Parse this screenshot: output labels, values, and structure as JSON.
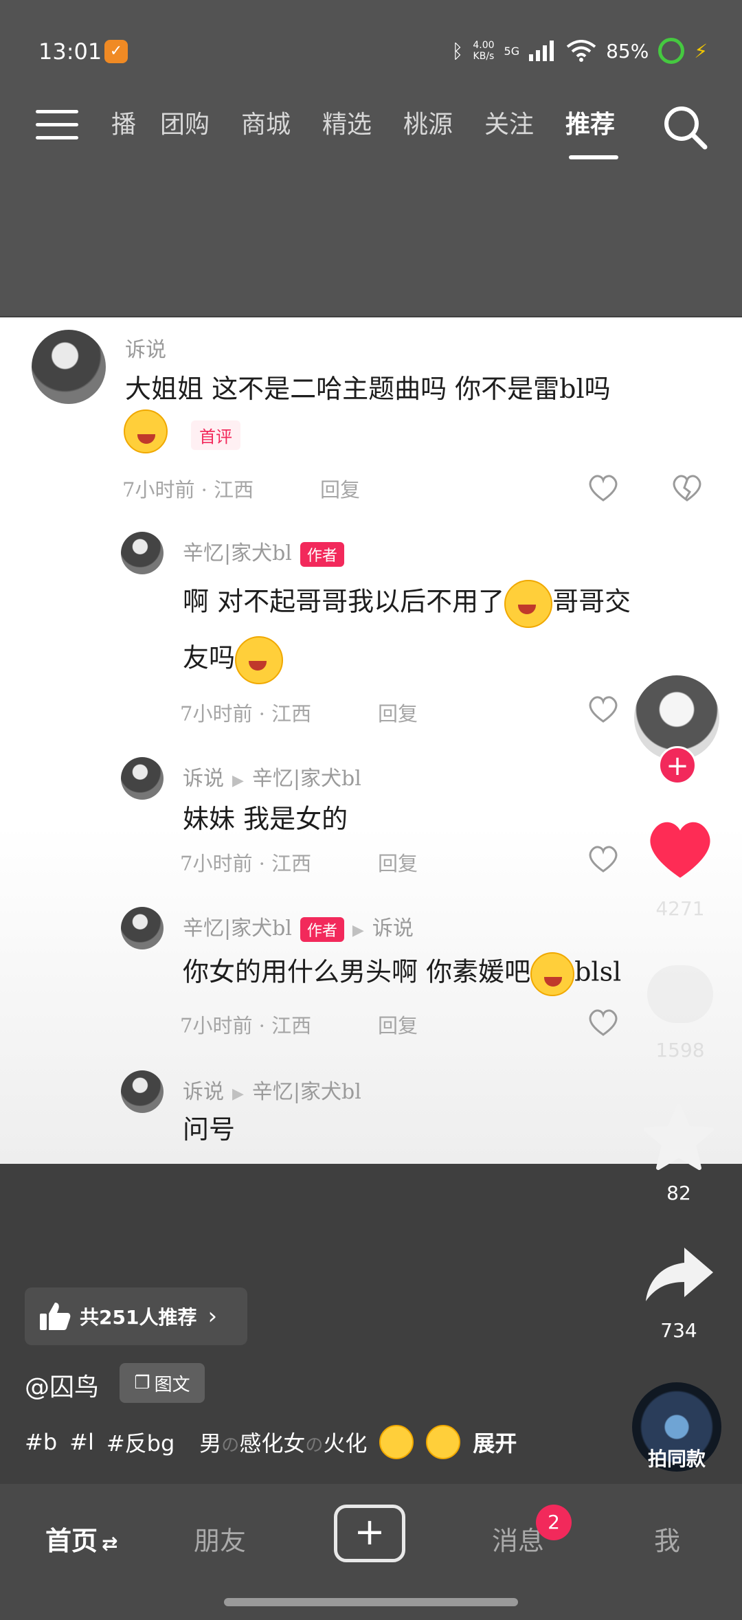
{
  "status_bar": {
    "time": "13:01",
    "net_speed": "4.00",
    "net_unit": "KB/s",
    "signal_label": "5G",
    "battery": "85%"
  },
  "top_nav": {
    "tabs": [
      "播",
      "团购",
      "商城",
      "精选",
      "桃源",
      "关注",
      "推荐"
    ],
    "active_tab": "推荐"
  },
  "comments": [
    {
      "user": "诉说",
      "text": "大姐姐 这不是二哈主题曲吗 你不是雷bl吗",
      "tag": "首评",
      "emoji": "laughing-crying-emoji",
      "meta": "7小时前 · 江西",
      "reply": "回复"
    },
    {
      "user": "辛忆|家犬bl",
      "author_tag": "作者",
      "text_line1": "啊 对不起哥哥我以后不用了",
      "text_line2_tail": "哥哥交",
      "text_line3": "友吗",
      "meta": "7小时前 · 江西",
      "reply": "回复"
    },
    {
      "user": "诉说",
      "reply_to": "辛忆|家犬bl",
      "text": "妹妹 我是女的",
      "meta": "7小时前 · 江西",
      "reply": "回复"
    },
    {
      "user": "辛忆|家犬bl",
      "author_tag": "作者",
      "reply_to": "诉说",
      "text": "你女的用什么男头啊 你素媛吧",
      "text_tail": "blsl",
      "meta": "7小时前 · 江西",
      "reply": "回复"
    },
    {
      "user": "诉说",
      "reply_to": "辛忆|家犬bl",
      "text": "问号"
    }
  ],
  "side_actions": {
    "likes": "4271",
    "comments": "1598",
    "favorites": "82",
    "shares": "734",
    "music_label": "拍同款"
  },
  "post": {
    "recommend_label": "共251人推荐",
    "author": "@囚鸟",
    "type_badge": "图文",
    "tags": [
      "#b",
      "#l",
      "#反bg"
    ],
    "desc_part1": "男",
    "desc_part2": "感化女",
    "desc_part3": "火化",
    "no_char": "の",
    "expand": "展开"
  },
  "bottom_nav": {
    "home": "首页",
    "friends": "朋友",
    "messages": "消息",
    "messages_badge": "2",
    "me": "我"
  },
  "colors": {
    "accent": "#f2295b",
    "panel_bg": "#ffffff",
    "app_bg": "#3f3f3f"
  }
}
